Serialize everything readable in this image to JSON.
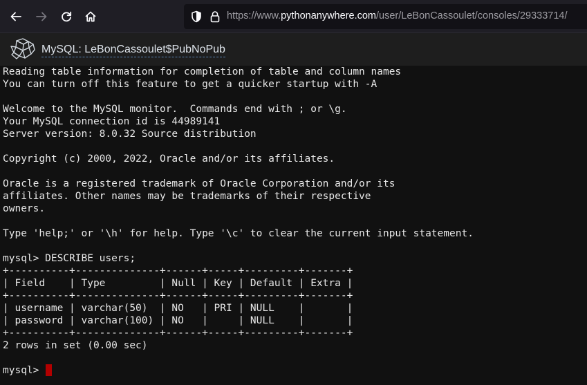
{
  "browser": {
    "url_prefix": "https://www.",
    "url_host": "pythonanywhere.com",
    "url_path": "/user/LeBonCassoulet/consoles/29333714/",
    "icons": [
      "back-arrow-icon",
      "forward-arrow-icon",
      "reload-icon",
      "home-icon",
      "shield-icon",
      "lock-icon"
    ]
  },
  "console": {
    "title": "MySQL: LeBonCassoulet$PubNoPub",
    "logo_icon": "pythonanywhere-logo-icon"
  },
  "terminal": {
    "lines": [
      "Reading table information for completion of table and column names",
      "You can turn off this feature to get a quicker startup with -A",
      "",
      "Welcome to the MySQL monitor.  Commands end with ; or \\g.",
      "Your MySQL connection id is 44989141",
      "Server version: 8.0.32 Source distribution",
      "",
      "Copyright (c) 2000, 2022, Oracle and/or its affiliates.",
      "",
      "Oracle is a registered trademark of Oracle Corporation and/or its",
      "affiliates. Other names may be trademarks of their respective",
      "owners.",
      "",
      "Type 'help;' or '\\h' for help. Type '\\c' to clear the current input statement.",
      "",
      "mysql> DESCRIBE users;",
      "+----------+--------------+------+-----+---------+-------+",
      "| Field    | Type         | Null | Key | Default | Extra |",
      "+----------+--------------+------+-----+---------+-------+",
      "| username | varchar(50)  | NO   | PRI | NULL    |       |",
      "| password | varchar(100) | NO   |     | NULL    |       |",
      "+----------+--------------+------+-----+---------+-------+",
      "2 rows in set (0.00 sec)",
      ""
    ],
    "prompt": "mysql> ",
    "cursor_color": "#b30000",
    "background_color": "#111111",
    "text_color": "#e8e8e8"
  }
}
